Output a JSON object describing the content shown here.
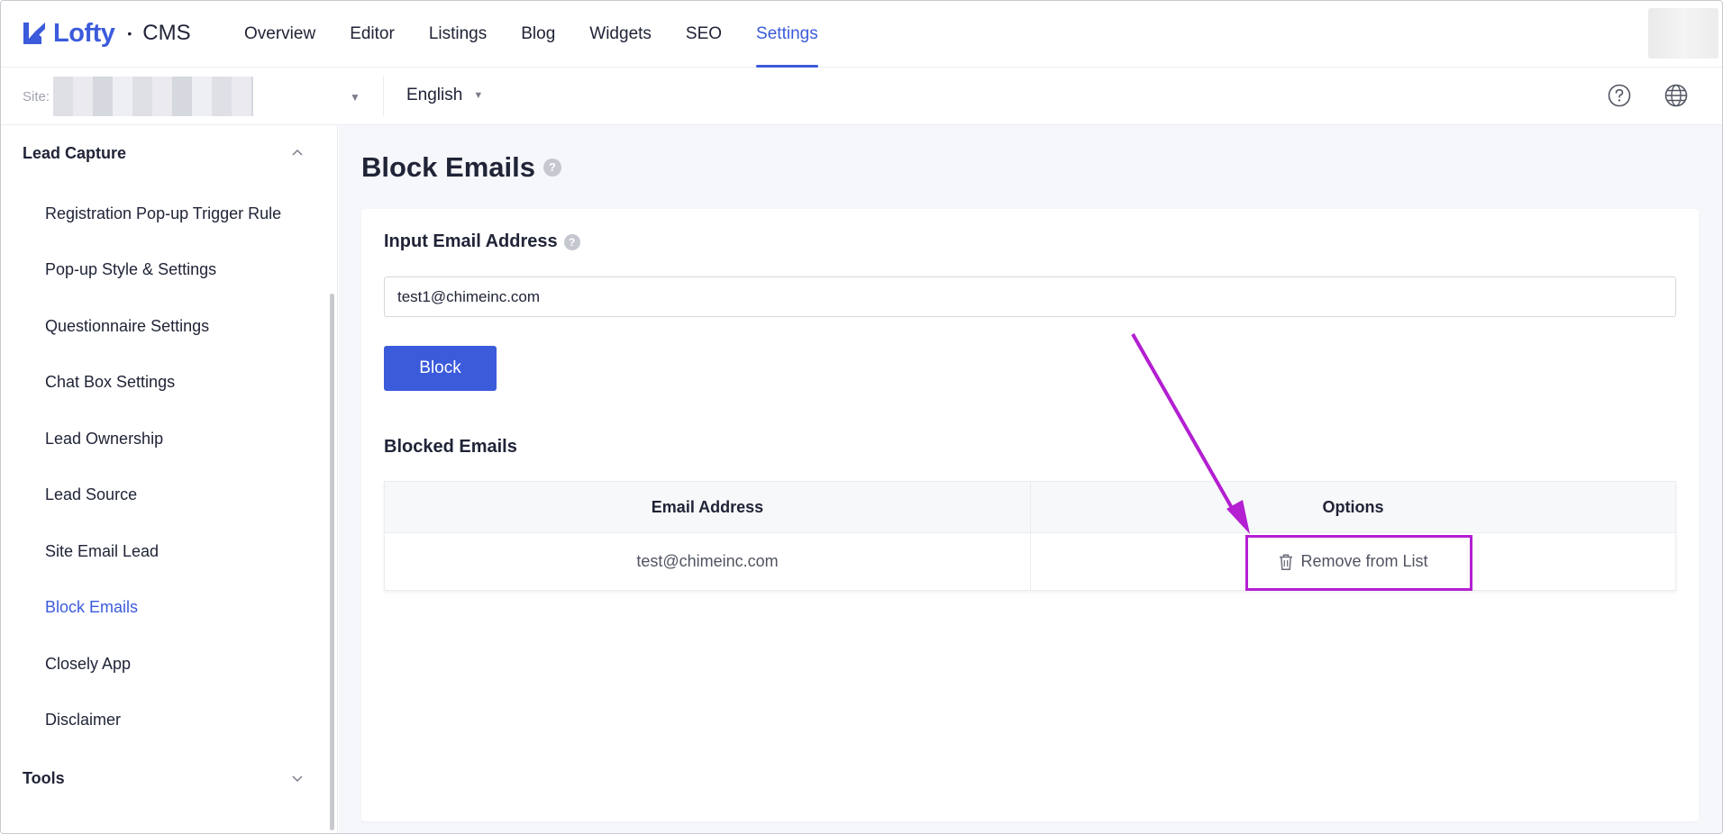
{
  "app": {
    "brand": "Lofty",
    "separator": "•",
    "product": "CMS"
  },
  "nav": {
    "tabs": [
      {
        "label": "Overview"
      },
      {
        "label": "Editor"
      },
      {
        "label": "Listings"
      },
      {
        "label": "Blog"
      },
      {
        "label": "Widgets"
      },
      {
        "label": "SEO"
      },
      {
        "label": "Settings",
        "active": true
      }
    ]
  },
  "subbar": {
    "site_label": "Site:",
    "language": "English"
  },
  "sidebar": {
    "section_lead_capture": "Lead Capture",
    "items": [
      {
        "label": "Registration Pop-up Trigger Rule"
      },
      {
        "label": "Pop-up Style & Settings"
      },
      {
        "label": "Questionnaire Settings"
      },
      {
        "label": "Chat Box Settings"
      },
      {
        "label": "Lead Ownership"
      },
      {
        "label": "Lead Source"
      },
      {
        "label": "Site Email Lead"
      },
      {
        "label": "Block Emails",
        "active": true
      },
      {
        "label": "Closely App"
      },
      {
        "label": "Disclaimer"
      }
    ],
    "section_tools": "Tools"
  },
  "main": {
    "title": "Block Emails",
    "input_label": "Input Email Address",
    "input_value": "test1@chimeinc.com",
    "block_button": "Block",
    "blocked_title": "Blocked Emails",
    "table": {
      "headers": [
        "Email Address",
        "Options"
      ],
      "rows": [
        {
          "email": "test@chimeinc.com",
          "option": "Remove from List"
        }
      ]
    }
  },
  "colors": {
    "accent": "#3b5bdb",
    "annotation": "#b31fd1"
  },
  "icons": {
    "help": "help-circle-icon",
    "globe": "globe-icon",
    "trash": "trash-icon",
    "question": "question-icon"
  }
}
